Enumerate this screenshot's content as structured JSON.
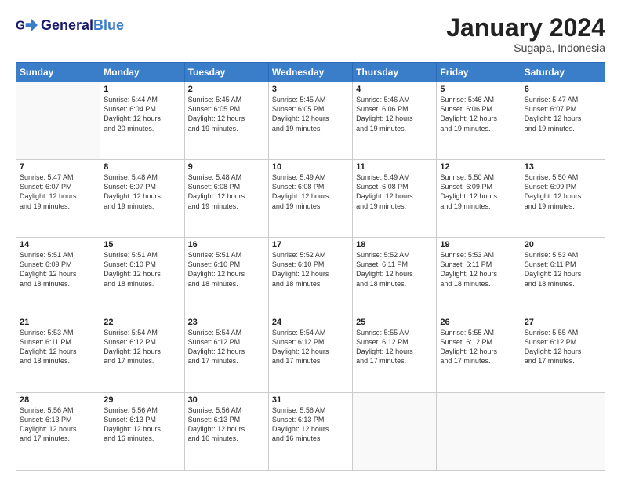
{
  "logo": {
    "general": "General",
    "blue": "Blue"
  },
  "header": {
    "month": "January 2024",
    "location": "Sugapa, Indonesia"
  },
  "weekdays": [
    "Sunday",
    "Monday",
    "Tuesday",
    "Wednesday",
    "Thursday",
    "Friday",
    "Saturday"
  ],
  "days": [
    {
      "num": "",
      "info": ""
    },
    {
      "num": "1",
      "info": "Sunrise: 5:44 AM\nSunset: 6:04 PM\nDaylight: 12 hours\nand 20 minutes."
    },
    {
      "num": "2",
      "info": "Sunrise: 5:45 AM\nSunset: 6:05 PM\nDaylight: 12 hours\nand 19 minutes."
    },
    {
      "num": "3",
      "info": "Sunrise: 5:45 AM\nSunset: 6:05 PM\nDaylight: 12 hours\nand 19 minutes."
    },
    {
      "num": "4",
      "info": "Sunrise: 5:46 AM\nSunset: 6:06 PM\nDaylight: 12 hours\nand 19 minutes."
    },
    {
      "num": "5",
      "info": "Sunrise: 5:46 AM\nSunset: 6:06 PM\nDaylight: 12 hours\nand 19 minutes."
    },
    {
      "num": "6",
      "info": "Sunrise: 5:47 AM\nSunset: 6:07 PM\nDaylight: 12 hours\nand 19 minutes."
    },
    {
      "num": "7",
      "info": "Sunrise: 5:47 AM\nSunset: 6:07 PM\nDaylight: 12 hours\nand 19 minutes."
    },
    {
      "num": "8",
      "info": "Sunrise: 5:48 AM\nSunset: 6:07 PM\nDaylight: 12 hours\nand 19 minutes."
    },
    {
      "num": "9",
      "info": "Sunrise: 5:48 AM\nSunset: 6:08 PM\nDaylight: 12 hours\nand 19 minutes."
    },
    {
      "num": "10",
      "info": "Sunrise: 5:49 AM\nSunset: 6:08 PM\nDaylight: 12 hours\nand 19 minutes."
    },
    {
      "num": "11",
      "info": "Sunrise: 5:49 AM\nSunset: 6:08 PM\nDaylight: 12 hours\nand 19 minutes."
    },
    {
      "num": "12",
      "info": "Sunrise: 5:50 AM\nSunset: 6:09 PM\nDaylight: 12 hours\nand 19 minutes."
    },
    {
      "num": "13",
      "info": "Sunrise: 5:50 AM\nSunset: 6:09 PM\nDaylight: 12 hours\nand 19 minutes."
    },
    {
      "num": "14",
      "info": "Sunrise: 5:51 AM\nSunset: 6:09 PM\nDaylight: 12 hours\nand 18 minutes."
    },
    {
      "num": "15",
      "info": "Sunrise: 5:51 AM\nSunset: 6:10 PM\nDaylight: 12 hours\nand 18 minutes."
    },
    {
      "num": "16",
      "info": "Sunrise: 5:51 AM\nSunset: 6:10 PM\nDaylight: 12 hours\nand 18 minutes."
    },
    {
      "num": "17",
      "info": "Sunrise: 5:52 AM\nSunset: 6:10 PM\nDaylight: 12 hours\nand 18 minutes."
    },
    {
      "num": "18",
      "info": "Sunrise: 5:52 AM\nSunset: 6:11 PM\nDaylight: 12 hours\nand 18 minutes."
    },
    {
      "num": "19",
      "info": "Sunrise: 5:53 AM\nSunset: 6:11 PM\nDaylight: 12 hours\nand 18 minutes."
    },
    {
      "num": "20",
      "info": "Sunrise: 5:53 AM\nSunset: 6:11 PM\nDaylight: 12 hours\nand 18 minutes."
    },
    {
      "num": "21",
      "info": "Sunrise: 5:53 AM\nSunset: 6:11 PM\nDaylight: 12 hours\nand 18 minutes."
    },
    {
      "num": "22",
      "info": "Sunrise: 5:54 AM\nSunset: 6:12 PM\nDaylight: 12 hours\nand 17 minutes."
    },
    {
      "num": "23",
      "info": "Sunrise: 5:54 AM\nSunset: 6:12 PM\nDaylight: 12 hours\nand 17 minutes."
    },
    {
      "num": "24",
      "info": "Sunrise: 5:54 AM\nSunset: 6:12 PM\nDaylight: 12 hours\nand 17 minutes."
    },
    {
      "num": "25",
      "info": "Sunrise: 5:55 AM\nSunset: 6:12 PM\nDaylight: 12 hours\nand 17 minutes."
    },
    {
      "num": "26",
      "info": "Sunrise: 5:55 AM\nSunset: 6:12 PM\nDaylight: 12 hours\nand 17 minutes."
    },
    {
      "num": "27",
      "info": "Sunrise: 5:55 AM\nSunset: 6:12 PM\nDaylight: 12 hours\nand 17 minutes."
    },
    {
      "num": "28",
      "info": "Sunrise: 5:56 AM\nSunset: 6:13 PM\nDaylight: 12 hours\nand 17 minutes."
    },
    {
      "num": "29",
      "info": "Sunrise: 5:56 AM\nSunset: 6:13 PM\nDaylight: 12 hours\nand 16 minutes."
    },
    {
      "num": "30",
      "info": "Sunrise: 5:56 AM\nSunset: 6:13 PM\nDaylight: 12 hours\nand 16 minutes."
    },
    {
      "num": "31",
      "info": "Sunrise: 5:56 AM\nSunset: 6:13 PM\nDaylight: 12 hours\nand 16 minutes."
    },
    {
      "num": "",
      "info": ""
    },
    {
      "num": "",
      "info": ""
    },
    {
      "num": "",
      "info": ""
    },
    {
      "num": "",
      "info": ""
    }
  ]
}
